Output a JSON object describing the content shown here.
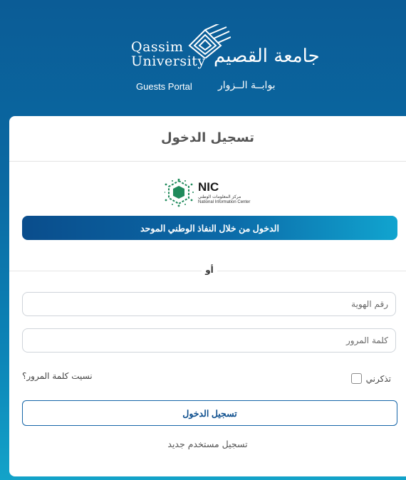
{
  "header": {
    "logo_en": "Qassim University",
    "logo_en_line1": "Qassim",
    "logo_en_line2": "University",
    "logo_ar": "جامعة القصيم",
    "portal_en": "Guests Portal",
    "portal_ar": "بوابــة الــزوار"
  },
  "card": {
    "title": "تسجيل الدخول",
    "nic": {
      "name": "NIC",
      "name_ar": "مركز المعلومات الوطني",
      "name_en": "National Information Center"
    },
    "nafath_button_label": "الدخول من خلال النفاذ الوطني الموحد",
    "or_label": "أو",
    "id_placeholder": "رقم الهوية",
    "password_placeholder": "كلمة المرور",
    "forgot_password_label": "نسيت كلمة المرور؟",
    "remember_me_label": "تذكرني",
    "remember_me_checked": false,
    "login_button_label": "تسجيل الدخول",
    "register_label": "تسجيل مستخدم جديد"
  },
  "colors": {
    "background_top": "#0b5c96",
    "background_bottom": "#13a3c9",
    "nic_green": "#1f8a5b",
    "button_primary": "#0a4d8c",
    "link_blue": "#0e4f8e"
  },
  "icons": {
    "logo_mark": "university-lattice-mark",
    "nic_mark": "nic-hexagon-mark"
  }
}
